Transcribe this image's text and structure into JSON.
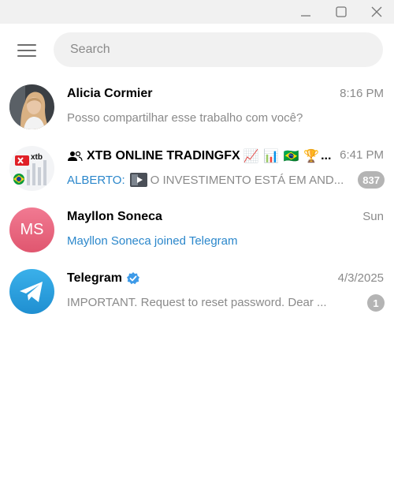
{
  "window": {
    "minimize_icon": "minimize-icon",
    "maximize_icon": "maximize-icon",
    "close_icon": "close-icon"
  },
  "header": {
    "menu_icon": "hamburger-menu-icon",
    "search_placeholder": "Search"
  },
  "colors": {
    "link_blue": "#2b87cb",
    "muted": "#8a8a8a",
    "badge": "#b4b4b4",
    "telegram_blue": "#2aa3e0",
    "ms_avatar": "#e8607a"
  },
  "chats": [
    {
      "name": "Alicia Cormier",
      "time": "8:16 PM",
      "preview": "Posso compartilhar esse trabalho com você?"
    },
    {
      "name": "XTB ONLINE TRADINGFX",
      "name_emojis": "📈 📊 🇧🇷 🏆",
      "name_ellipsis": "...",
      "time": "6:41 PM",
      "preview_sender": "ALBERTO:",
      "preview": "O INVESTIMENTO ESTÁ EM AND...",
      "badge": "837",
      "avatar_text": "xtb"
    },
    {
      "name": "Mayllon Soneca",
      "time": "Sun",
      "preview": "Mayllon Soneca joined Telegram",
      "avatar_text": "MS"
    },
    {
      "name": "Telegram",
      "time": "4/3/2025",
      "preview": "IMPORTANT. Request to reset password.  Dear ...",
      "badge": "1"
    }
  ]
}
